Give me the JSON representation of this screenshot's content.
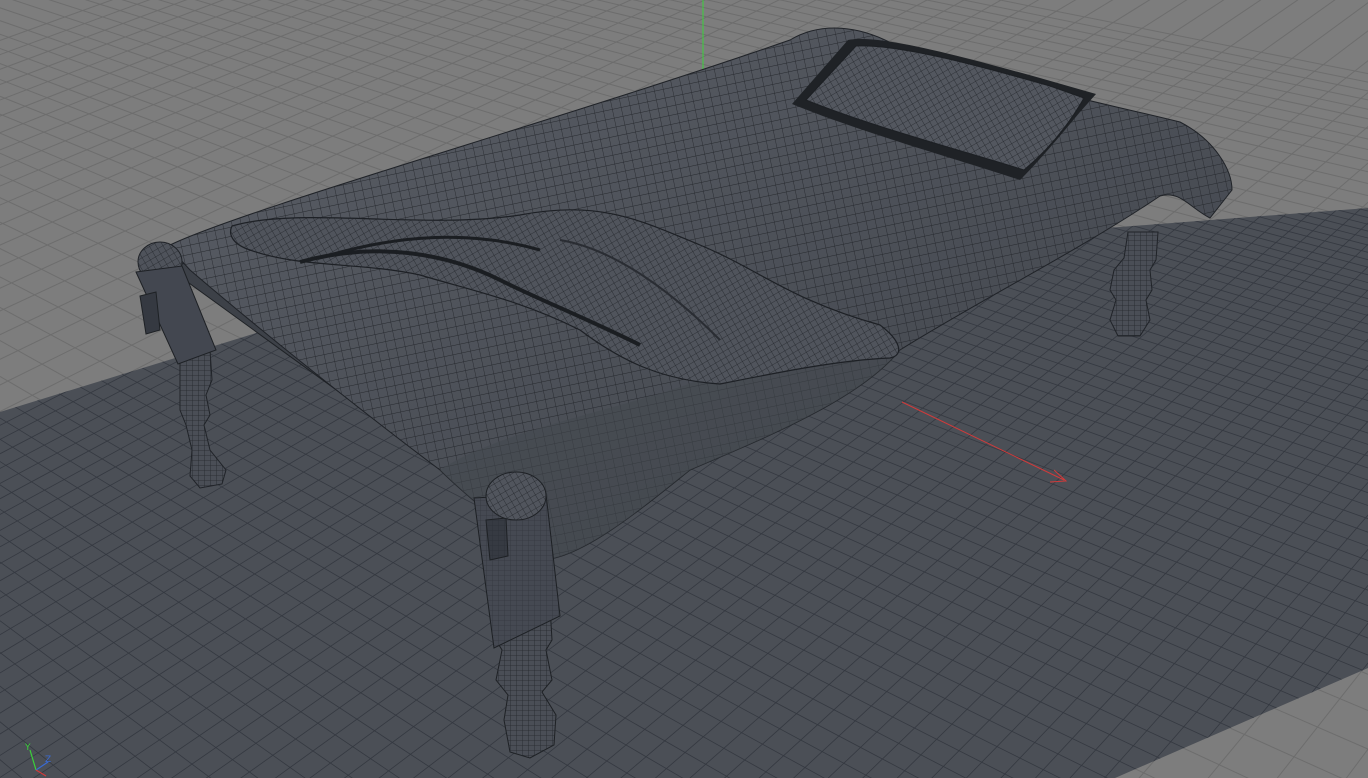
{
  "viewport": {
    "view_type": "perspective",
    "shading": "wireframe-on-shaded",
    "colors": {
      "background": "#7d7d7d",
      "grid_line": "#6d6d6d",
      "floor_plane": "#4b4f56",
      "floor_grid": "#353941",
      "mesh_fill": "#4e525a",
      "mesh_wire": "#26292e",
      "y_axis": "#3ad13a",
      "x_axis": "#d23a3a",
      "z_axis": "#3a6ad2"
    }
  },
  "axis_gizmo": {
    "y_label": "Y",
    "z_label": "Z"
  }
}
